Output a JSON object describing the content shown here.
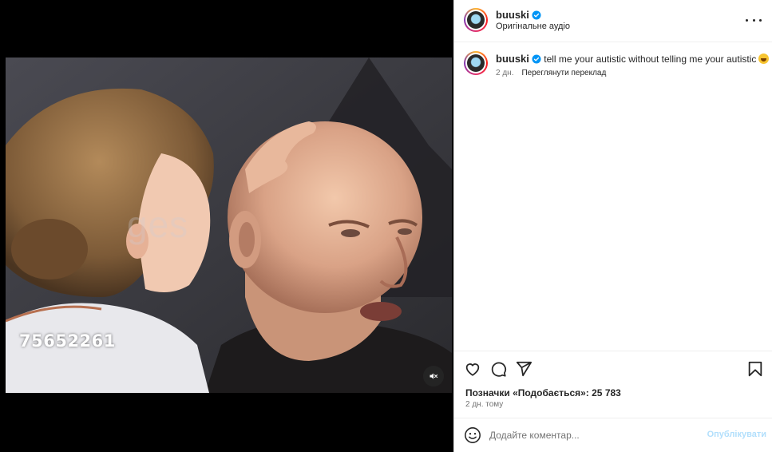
{
  "video": {
    "overlay_id": "75652261",
    "watermark": "ges",
    "mute_icon": "muted-speaker-icon"
  },
  "header": {
    "username": "buuski",
    "audio_label": "Оригінальне аудіо",
    "more_icon": "more-options-icon"
  },
  "caption": {
    "username": "buuski",
    "text": "tell me your autistic without telling me your autistic",
    "emoji": "rolling-on-floor-laughing-emoji",
    "age": "2 дн.",
    "translate_label": "Переглянути переклад"
  },
  "actions": {
    "icons": [
      "heart-icon",
      "comment-icon",
      "share-icon",
      "bookmark-icon"
    ],
    "likes_text": "Позначки «Подобається»: 25 783",
    "posted_ago": "2 дн. тому"
  },
  "comment": {
    "placeholder": "Додайте коментар...",
    "post_label": "Опублікувати"
  },
  "colors": {
    "verified": "#0095f6",
    "post_disabled": "#b2dffc",
    "secondary_text": "#737373"
  }
}
